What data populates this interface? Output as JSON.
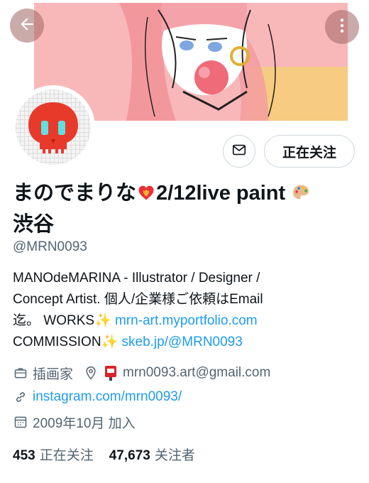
{
  "header": {
    "back_icon": "arrow-left-icon",
    "more_icon": "more-vertical-icon"
  },
  "actions": {
    "message_icon": "mail-icon",
    "follow_label": "正在关注"
  },
  "profile": {
    "name_text": "まのでまりな",
    "name_mid": "2/12live paint",
    "name_line2": "渋谷",
    "handle": "@MRN0093"
  },
  "bio": {
    "line1": "MANOdeMARINA - Illustrator / Designer /",
    "line2": "Concept Artist. 個人/企業様ご依頼はEmail",
    "line3_prefix": "迄。 WORKS",
    "works_link": "mrn-art.myportfolio.com",
    "line4_prefix": "COMMISSION",
    "commission_link": "skeb.jp/@MRN0093"
  },
  "meta": {
    "profession": "插画家",
    "email": "mrn0093.art@gmail.com",
    "website": "instagram.com/mrn0093/",
    "joined": "2009年10月 加入"
  },
  "stats": {
    "following_count": "453",
    "following_label": "正在关注",
    "followers_count": "47,673",
    "followers_label": "关注者"
  },
  "colors": {
    "link": "#1d9bf0",
    "muted": "#536471",
    "banner_bg": "#f8b8ba"
  }
}
